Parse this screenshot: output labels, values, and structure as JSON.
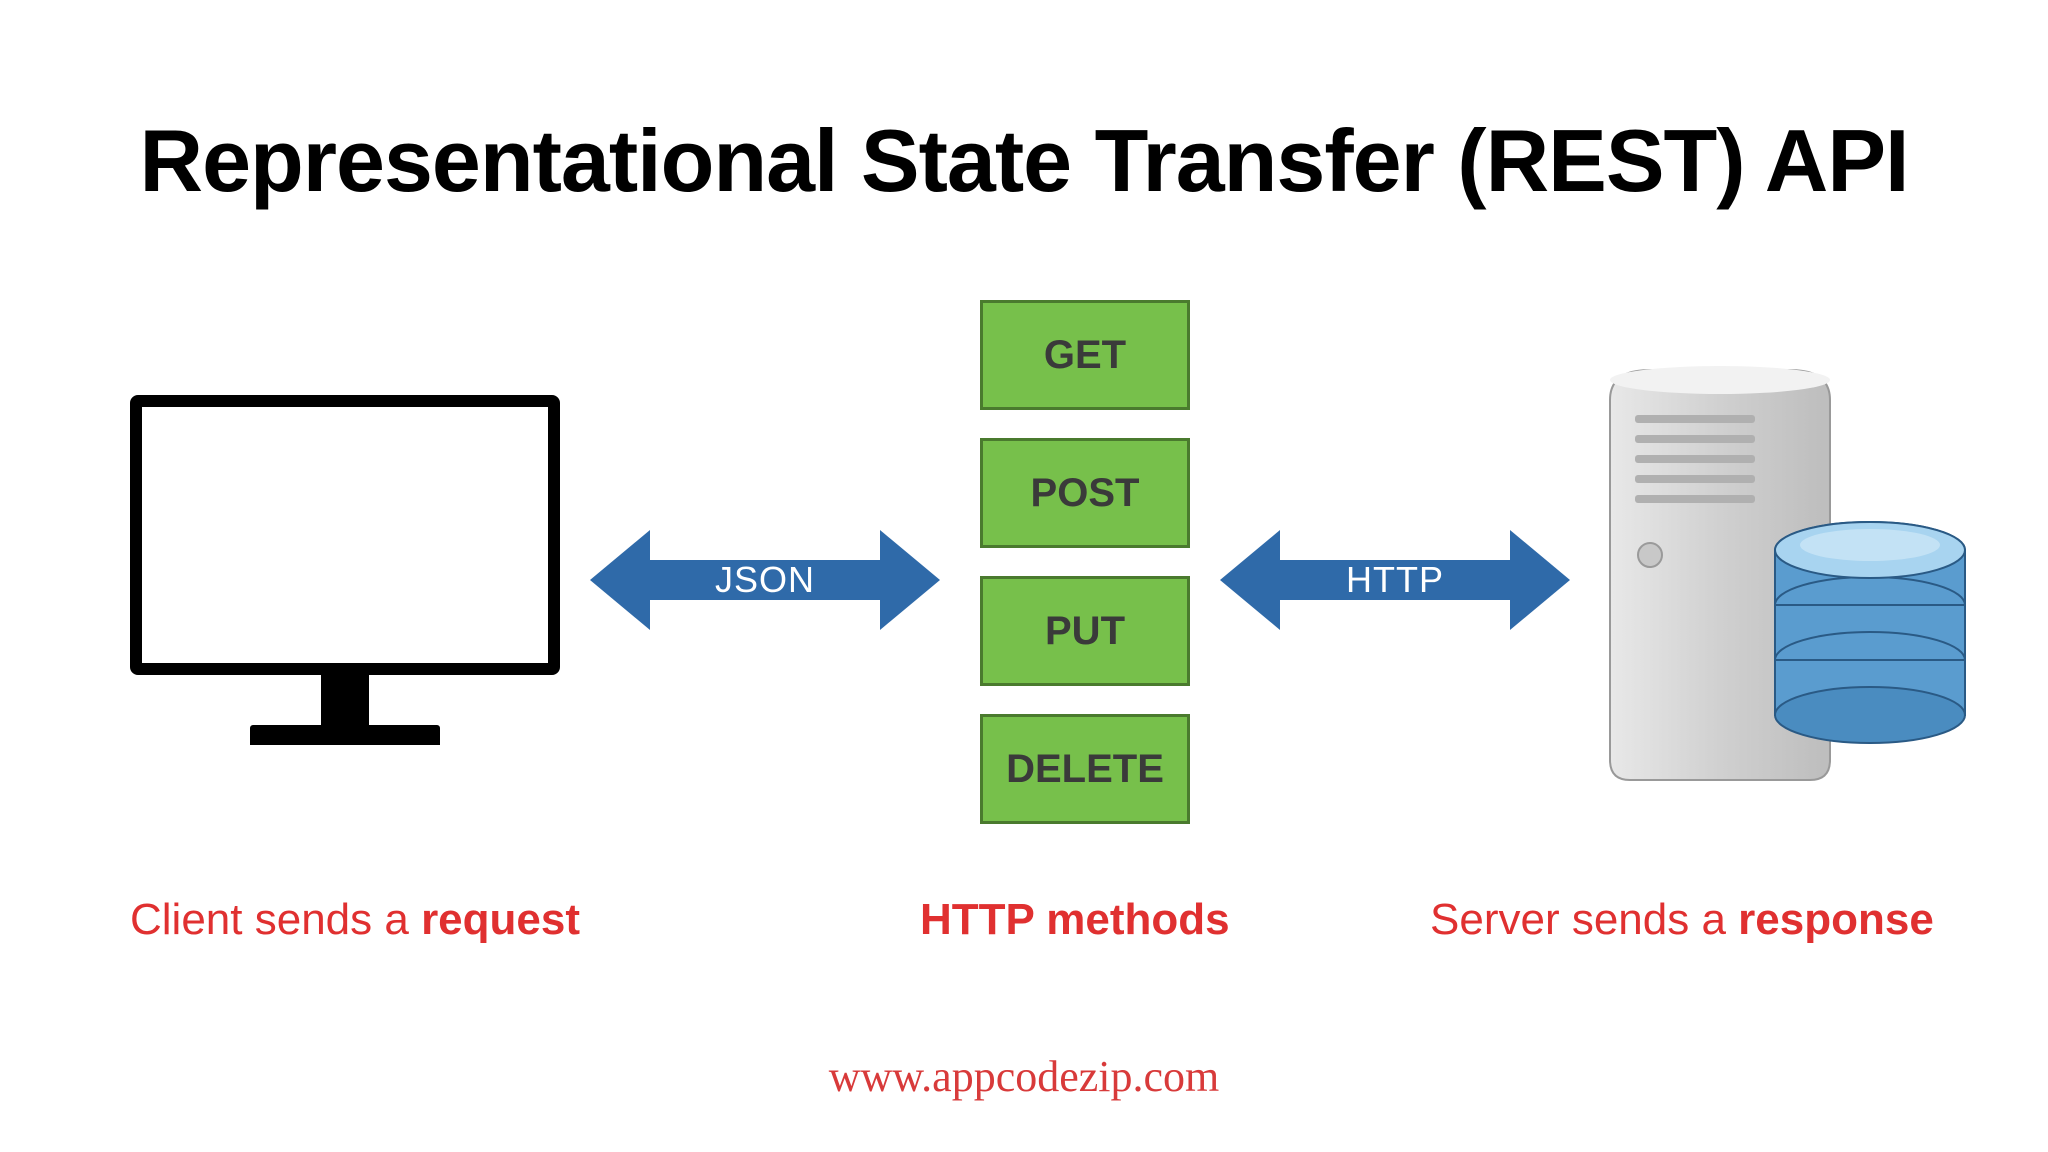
{
  "title": "Representational State Transfer (REST) API",
  "arrows": {
    "json_label": "JSON",
    "http_label": "HTTP"
  },
  "methods": [
    "GET",
    "POST",
    "PUT",
    "DELETE"
  ],
  "captions": {
    "client_prefix": "Client sends a ",
    "client_bold": "request",
    "methods": "HTTP methods",
    "server_prefix": "Server sends a ",
    "server_bold": "response"
  },
  "footer": "www.appcodezip.com"
}
